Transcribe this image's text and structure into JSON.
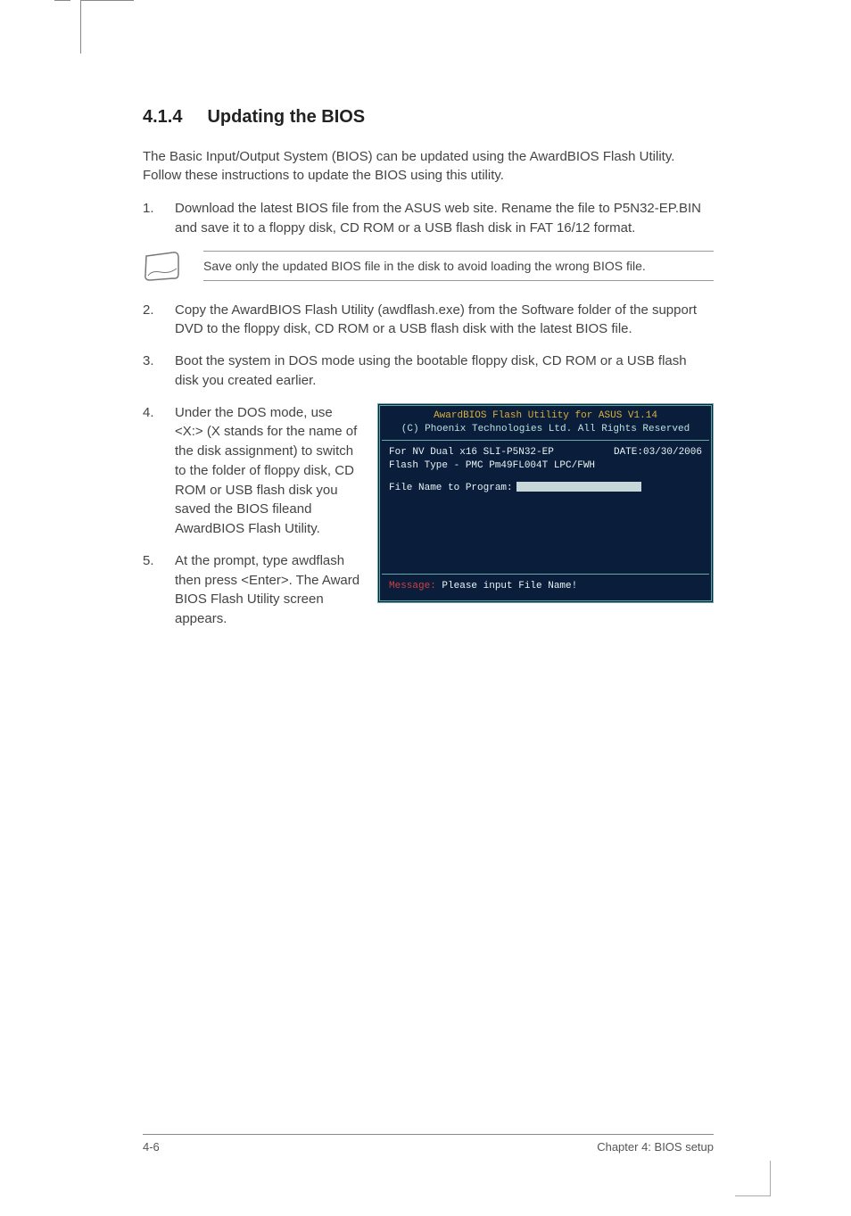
{
  "heading": {
    "number": "4.1.4",
    "title": "Updating the BIOS"
  },
  "intro": "The Basic Input/Output System (BIOS) can be updated using the AwardBIOS Flash Utility. Follow these instructions to update the BIOS using this utility.",
  "steps": {
    "s1n": "1.",
    "s1": "Download the latest BIOS file from the ASUS web site. Rename the file to P5N32-EP.BIN and save it to a floppy disk, CD ROM or a USB flash disk in FAT 16/12 format.",
    "s2n": "2.",
    "s2": "Copy the AwardBIOS Flash Utility (awdflash.exe) from the Software folder of the support DVD to the floppy disk, CD ROM or a USB flash disk with the latest BIOS file.",
    "s3n": "3.",
    "s3": "Boot the system in DOS mode using the bootable floppy disk, CD ROM or a USB flash disk you created earlier.",
    "s4n": "4.",
    "s4": "Under the DOS mode, use <X:> (X stands for the name of the disk assignment) to switch to the folder of floppy disk, CD ROM or USB flash disk you saved the BIOS fileand AwardBIOS Flash Utility.",
    "s5n": "5.",
    "s5": "At the prompt, type awdflash then press <Enter>. The Award BIOS Flash Utility screen appears."
  },
  "note": "Save only the updated BIOS file in the disk to avoid loading the wrong BIOS file.",
  "bios": {
    "hdr": "AwardBIOS Flash Utility for ASUS V1.14",
    "hdr2": "(C) Phoenix Technologies Ltd. All Rights Reserved",
    "line1a": "For NV Dual x16 SLI-P5N32-EP",
    "line1b": "DATE:03/30/2006",
    "line2": "Flash Type - PMC Pm49FL004T LPC/FWH",
    "prog": "File Name to Program:",
    "msgLabel": "Message:",
    "msgText": " Please input File Name!"
  },
  "footer": {
    "left": "4-6",
    "right": "Chapter 4: BIOS setup"
  }
}
